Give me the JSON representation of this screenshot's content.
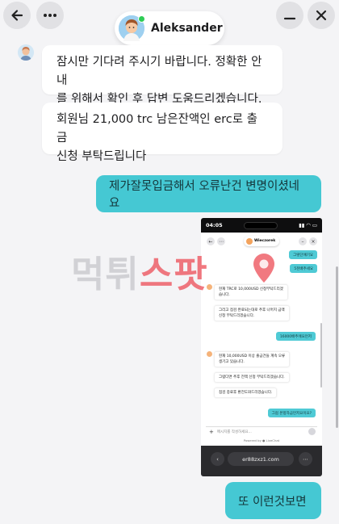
{
  "header": {
    "contact_name": "Aleksander",
    "back_icon": "arrow-left-icon",
    "more_icon": "more-horizontal-icon",
    "minimize_icon": "minimize-icon",
    "close_icon": "close-icon",
    "status_color": "#2ecc55"
  },
  "messages": [
    {
      "side": "incoming",
      "lines": [
        "잠시만 기다려 주시기 바랍니다. 정확한 안내",
        "를 위해서 확인 후 답변 도움드리겠습니다."
      ]
    },
    {
      "side": "incoming",
      "lines": [
        "회원님 21,000 trc 남은잔액인 erc로 출금",
        "신청 부탁드립니다"
      ]
    },
    {
      "side": "outgoing",
      "text": "제가잘못입금해서 오류난건 변명이셨네요"
    },
    {
      "side": "outgoing",
      "type": "image",
      "alt": "embedded chat screenshot"
    },
    {
      "side": "outgoing",
      "text": "또 이런것보면"
    }
  ],
  "embedded_screenshot": {
    "status_time": "04:05",
    "status_icons": "▮▮ ◠ ▭",
    "agent_name": "Wieczorek",
    "messages": [
      {
        "side": "outgoing",
        "text": "그렇단얘기요"
      },
      {
        "side": "outgoing",
        "text": "5천배추세요"
      },
      {
        "side": "incoming",
        "lines": [
          "현재 TRC로 10,000USD 신청부탁드리겠",
          "습니다."
        ]
      },
      {
        "side": "incoming",
        "lines": [
          "그리고 점검 완료되는대로 추후 나머지 금액",
          "신청 부탁드리겠습니다."
        ]
      },
      {
        "side": "outgoing",
        "text": "16000배추에요먼저"
      },
      {
        "side": "incoming",
        "lines": [
          "현재 10,000USD 이상 출금건들 계속 오류",
          "생기고 있습니다."
        ]
      },
      {
        "side": "incoming",
        "lines": [
          "그럼다면 추후 전액 신청 부탁드리겠습니다."
        ]
      },
      {
        "side": "incoming",
        "lines": [
          "점검 종료후 환전도와드리겠습니다."
        ]
      },
      {
        "side": "outgoing",
        "text": "그럼 본항자금먼저요이요?"
      }
    ],
    "input_placeholder": "메시지를 작성하세요...",
    "powered_by": "Powered by ● LiveChat",
    "url": "er88zxz1.com"
  },
  "watermark": {
    "text_part1": "먹튀",
    "text_part2": "스팟",
    "color1": "#b4b4b9",
    "color2": "#ec4c56"
  },
  "colors": {
    "background": "#f4f4f6",
    "outgoing_bubble": "#45c8d3",
    "incoming_bubble": "#ffffff"
  }
}
